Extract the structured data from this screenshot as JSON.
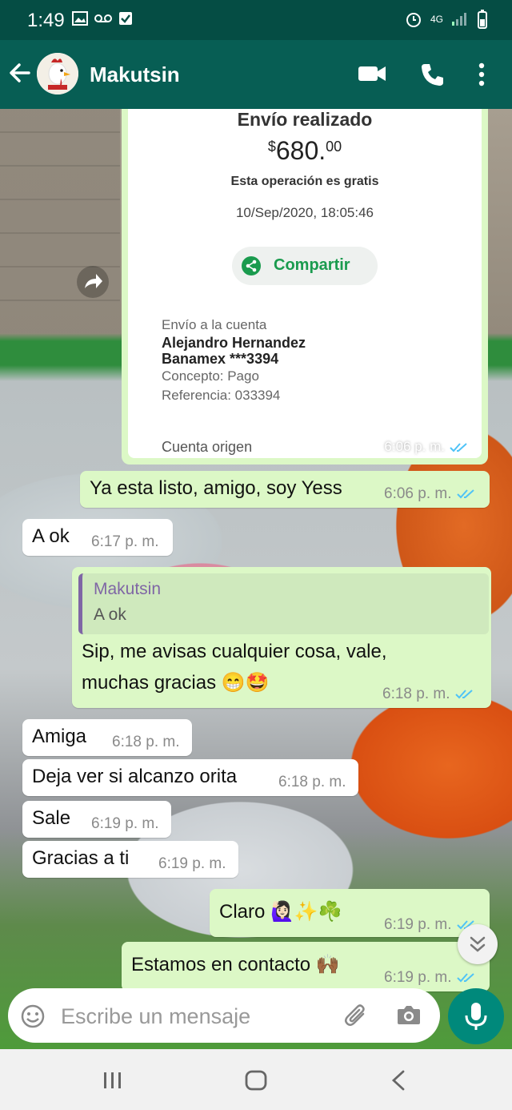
{
  "status_bar": {
    "time": "1:49",
    "network": "4G"
  },
  "header": {
    "contact_name": "Makutsin"
  },
  "receipt": {
    "title": "Envío realizado",
    "amount_currency": "$",
    "amount_int": "680.",
    "amount_dec": "00",
    "note": "Esta operación es gratis",
    "datetime": "10/Sep/2020, 18:05:46",
    "share_label": "Compartir",
    "account_heading": "Envío a la cuenta",
    "account_name": "Alejandro Hernandez",
    "account_bank": "Banamex ***3394",
    "concept": "Concepto: Pago",
    "reference": "Referencia: 033394",
    "origin": "Cuenta origen",
    "time": "6:06 p. m."
  },
  "messages": [
    {
      "dir": "out",
      "text": "Ya esta listo, amigo, soy Yess",
      "time": "6:06 p. m."
    },
    {
      "dir": "in",
      "text": "A ok",
      "time": "6:17 p. m."
    },
    {
      "dir": "out",
      "quote_name": "Makutsin",
      "quote_text": "A ok",
      "text1": "Sip, me avisas cualquier cosa, vale,",
      "text2": "muchas gracias 😁🤩",
      "time": "6:18 p. m."
    },
    {
      "dir": "in",
      "text": "Amiga",
      "time": "6:18 p. m."
    },
    {
      "dir": "in",
      "text": "Deja ver si alcanzo orita",
      "time": "6:18 p. m."
    },
    {
      "dir": "in",
      "text": "Sale",
      "time": "6:19 p. m."
    },
    {
      "dir": "in",
      "text": "Gracias a ti",
      "time": "6:19 p. m."
    },
    {
      "dir": "out",
      "text": "Claro 🙋🏻‍♀️✨☘️",
      "time": "6:19 p. m."
    },
    {
      "dir": "out",
      "text": "Estamos en contacto 🙌🏾",
      "time": "6:19 p. m."
    }
  ],
  "composer": {
    "placeholder": "Escribe un mensaje"
  },
  "colors": {
    "header": "#075e54",
    "outgoing": "#dcf8c6",
    "incoming": "#ffffff",
    "tick": "#4fc3f7",
    "mic": "#00897b"
  }
}
